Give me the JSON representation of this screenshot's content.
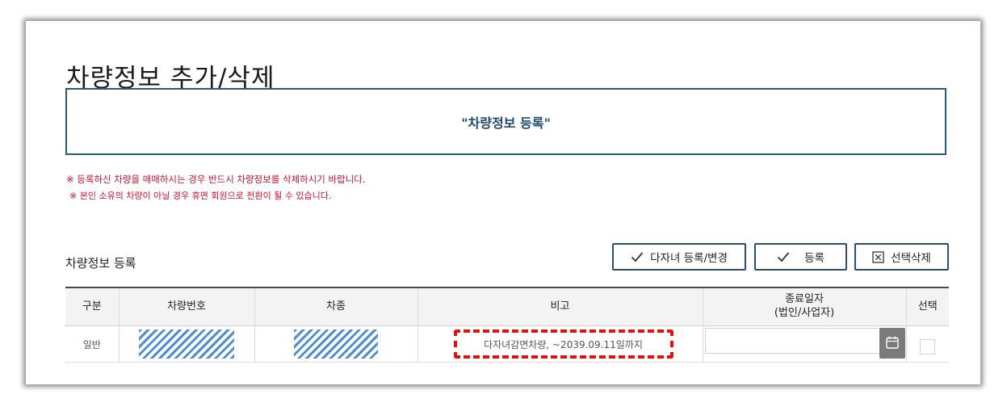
{
  "page": {
    "title": "차량정보 추가/삭제"
  },
  "banner": {
    "text": "\"차량정보 등록\""
  },
  "notices": [
    "※ 등록하신 차량을 매매하시는 경우 반드시 차량정보를 삭제하시기 바랍니다.",
    "※ 본인 소유의 차량이 아닐 경우 휴면 회원으로 전환이 될 수 있습니다."
  ],
  "section": {
    "title": "차량정보 등록"
  },
  "buttons": {
    "family_label": "다자녀 등록/변경",
    "register_label": "등록",
    "delete_label": "선택삭제"
  },
  "table": {
    "headers": {
      "type": "구분",
      "plate": "차량번호",
      "model": "차종",
      "remark": "비고",
      "end_date_line1": "종료일자",
      "end_date_line2": "(법인/사업자)",
      "select": "선택"
    },
    "rows": [
      {
        "type": "일반",
        "remark": "다자녀감면차량, ~2039.09.11일까지",
        "end_date": ""
      }
    ]
  },
  "icons": {
    "check": "check-icon",
    "checkbox_x": "checkbox-x-icon",
    "calendar": "calendar-icon"
  },
  "colors": {
    "accent_border": "#2d5876",
    "notice_text": "#c8102e",
    "highlight_dash": "#e01010",
    "masked_stripe": "#4f8fd0"
  }
}
